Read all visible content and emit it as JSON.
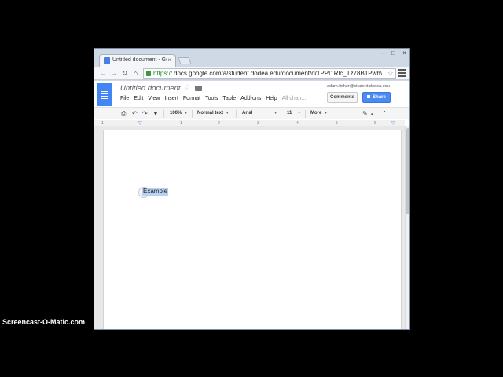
{
  "browser": {
    "tab_title": "Untitled document - Goo",
    "url_protocol": "https://",
    "url_rest": "docs.google.com/a/student.dodea.edu/document/d/1PPI1Rlc_Tz78B1Pwh\\"
  },
  "docs": {
    "title": "Untitled document",
    "menu": [
      "File",
      "Edit",
      "View",
      "Insert",
      "Format",
      "Tools",
      "Table",
      "Add-ons",
      "Help"
    ],
    "all_changes": "All chan...",
    "account": "adam.fisher@student.dodea.edu",
    "comments_label": "Comments",
    "share_label": "Share",
    "accent": "#4285f4"
  },
  "format_bar": {
    "zoom": "100%",
    "style": "Normal text",
    "font": "Arial",
    "size": "11",
    "more": "More"
  },
  "ruler": [
    "1",
    "1",
    "2",
    "3",
    "4",
    "5",
    "6"
  ],
  "document": {
    "selected_text": "Example"
  },
  "watermark": "Screencast-O-Matic.com"
}
